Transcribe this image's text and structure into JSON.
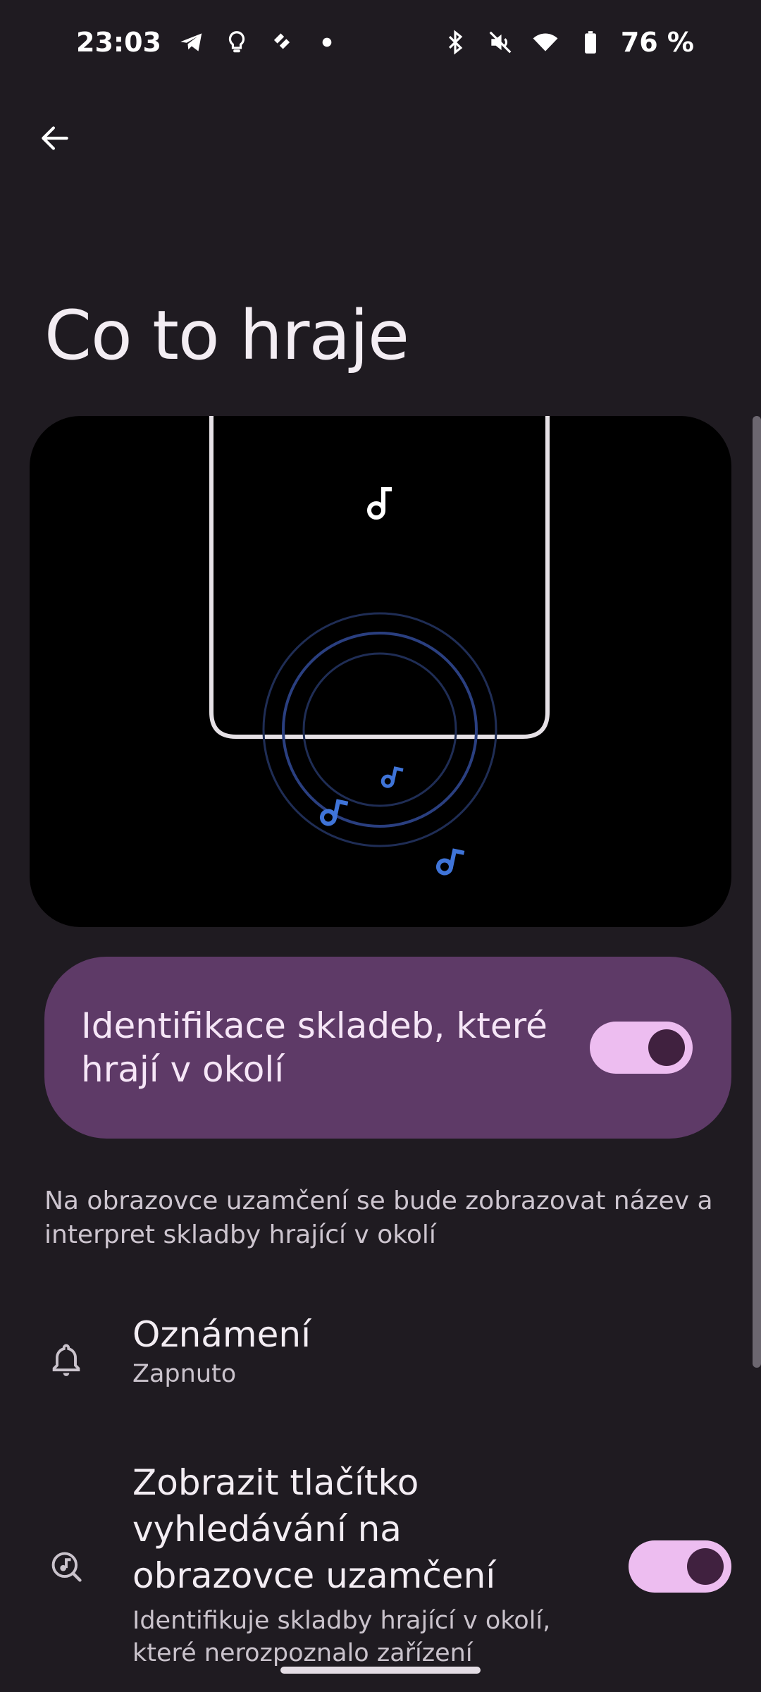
{
  "status_bar": {
    "time": "23:03",
    "battery": "76 %",
    "icons_left": [
      "telegram-icon",
      "lightbulb-icon",
      "app-icon",
      "dot-icon"
    ],
    "icons_right": [
      "bluetooth-icon",
      "mute-icon",
      "wifi-icon",
      "battery-icon"
    ]
  },
  "page": {
    "title": "Co to hraje"
  },
  "main_toggle": {
    "label": "Identifikace skladeb, které hrají v okolí",
    "state": "on"
  },
  "description": "Na obrazovce uzamčení se bude zobrazovat název a interpret skladby hrající v okolí",
  "settings": [
    {
      "title": "Oznámení",
      "subtitle": "Zapnuto",
      "icon": "bell-icon"
    },
    {
      "title": "Zobrazit tlačítko vyhledávání na obrazovce uzamčení",
      "subtitle": "Identifikuje skladby hrající v okolí, které nerozpoznalo zařízení",
      "icon": "music-search-icon",
      "state": "on"
    }
  ],
  "colors": {
    "background": "#1f1b21",
    "card": "#5e3a67",
    "switch_track": "#edbdf0",
    "switch_knob": "#40213f",
    "accent_blue": "#3f74d8"
  }
}
